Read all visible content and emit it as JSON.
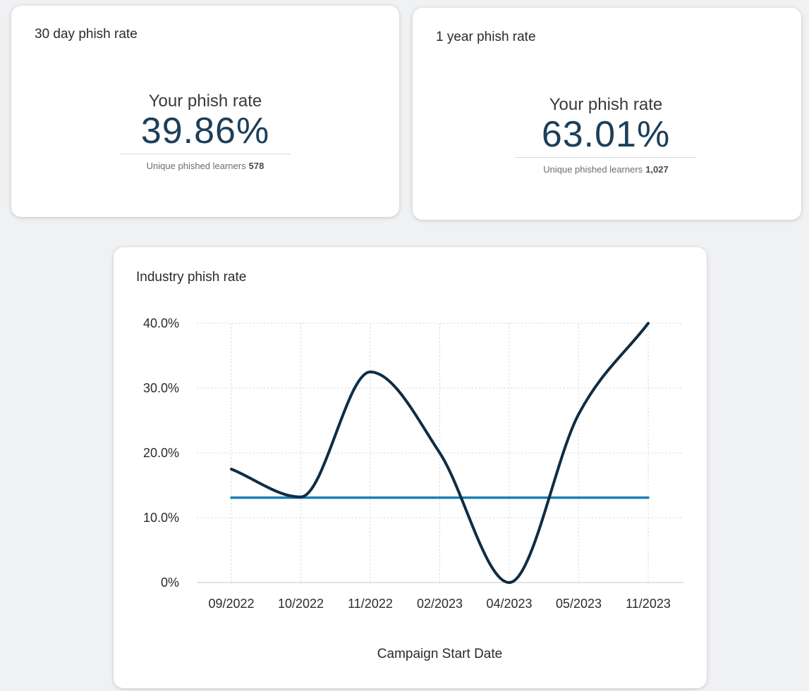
{
  "card_30_day": {
    "title": "30 day phish rate",
    "rate_label": "Your phish rate",
    "rate_value": "39.86%",
    "learners_label": "Unique phished learners",
    "learners_count": "578"
  },
  "card_1_year": {
    "title": "1 year phish rate",
    "rate_label": "Your phish rate",
    "rate_value": "63.01%",
    "learners_label": "Unique phished learners",
    "learners_count": "1,027"
  },
  "industry_card": {
    "title": "Industry phish rate"
  },
  "chart_data": {
    "type": "line",
    "title": "Industry phish rate",
    "xlabel": "Campaign Start Date",
    "ylabel": "",
    "categories": [
      "09/2022",
      "10/2022",
      "11/2022",
      "02/2023",
      "04/2023",
      "05/2023",
      "11/2023"
    ],
    "series": [
      {
        "values": [
          17.5,
          13.2,
          32.5,
          20.0,
          0.0,
          26.0,
          40.0
        ],
        "color": "#0f2d44",
        "smooth": true
      },
      {
        "values": [
          13.1,
          13.1,
          13.1,
          13.1,
          13.1,
          13.1,
          13.1
        ],
        "color": "#1a7fb5",
        "smooth": false
      }
    ],
    "ylim": [
      0,
      40
    ],
    "yticks": [
      0,
      10,
      20,
      30,
      40
    ],
    "ytick_labels": [
      "0%",
      "10.0%",
      "20.0%",
      "30.0%",
      "40.0%"
    ],
    "grid": true,
    "legend": "none"
  }
}
